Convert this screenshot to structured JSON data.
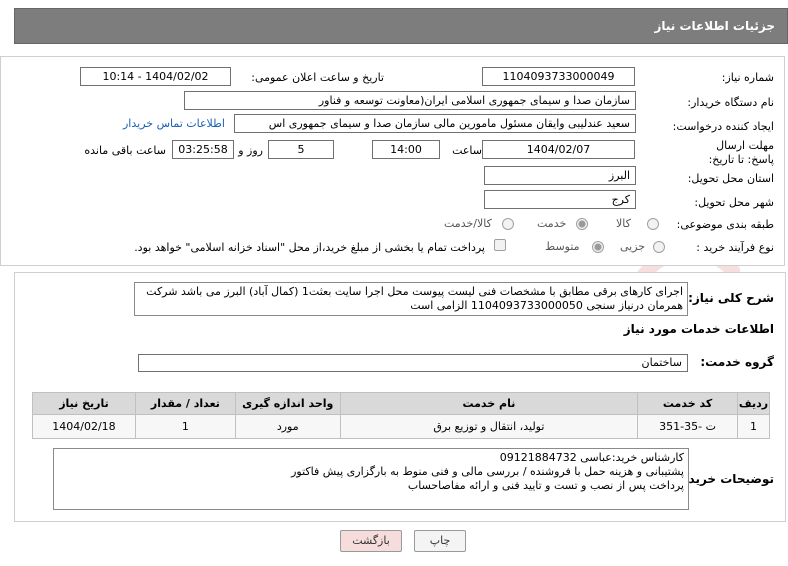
{
  "header": {
    "title": "جزئیات اطلاعات نیاز"
  },
  "need": {
    "need_number_label": "شماره نیاز:",
    "need_number": "1104093733000049",
    "announce_label": "تاریخ و ساعت اعلان عمومی:",
    "announce_value": "1404/02/02 - 10:14",
    "buyer_label": "نام دستگاه خریدار:",
    "buyer_value": "سازمان صدا و سیمای جمهوری اسلامی ایران(معاونت توسعه و فناور",
    "creator_label": "ایجاد کننده درخواست:",
    "creator_value": "سعید عندلیبی وایقان مسئول مامورین مالی  سازمان صدا و سیمای جمهوری اس",
    "contact_link": "اطلاعات تماس خریدار",
    "deadline_label": "مهلت ارسال پاسخ: تا تاریخ:",
    "deadline_date": "1404/02/07",
    "time_label": "ساعت",
    "deadline_time": "14:00",
    "days_value": "5",
    "days_label": "روز و",
    "remaining_time": "03:25:58",
    "remaining_label": "ساعت باقی مانده",
    "province_label": "استان محل تحویل:",
    "province_value": "البرز",
    "city_label": "شهر محل تحویل:",
    "city_value": "کرج",
    "category_label": "طبقه بندی موضوعی:",
    "category_options": [
      "کالا",
      "خدمت",
      "کالا/خدمت"
    ],
    "process_label": "نوع فرآیند خرید :",
    "process_options": [
      "جزیی",
      "متوسط"
    ],
    "payment_note": "پرداخت تمام یا بخشی از مبلغ خرید،از محل \"اسناد خزانه اسلامی\" خواهد بود."
  },
  "description": {
    "label": "شرح کلی نیاز:",
    "text": "اجرای کارهای برقی مطابق با مشخصات فنی لیست پیوست محل اجرا سایت بعثت1 (کمال آباد) البرز می باشد شرکت همرمان درنیاز سنجی 1104093733000050 الزامی است"
  },
  "services": {
    "title": "اطلاعات خدمات مورد نیاز",
    "group_label": "گروه خدمت:",
    "group_value": "ساختمان",
    "columns": [
      "ردیف",
      "کد خدمت",
      "نام خدمت",
      "واحد اندازه گیری",
      "تعداد / مقدار",
      "تاریخ نیاز"
    ],
    "rows": [
      [
        "1",
        "ت -35-351",
        "تولید، انتقال و توزیع برق",
        "مورد",
        "1",
        "1404/02/18"
      ]
    ]
  },
  "buyer_notes": {
    "label": "توضیحات خریدار:",
    "lines": [
      "کارشناس خرید:عباسی 09121884732",
      "پشتیبانی و هزینه حمل با فروشنده / بررسی مالی و فنی منوط به بارگزاری پیش فاکتور",
      "پرداخت پس از نصب و تست و تایید فنی و ارائه مفاصاحساب"
    ]
  },
  "buttons": {
    "print": "چاپ",
    "back": "بازگشت"
  },
  "colors": {
    "header_bg": "#7d7d7d",
    "link": "#1a5fb4",
    "back_btn": "#f7dcdc"
  }
}
